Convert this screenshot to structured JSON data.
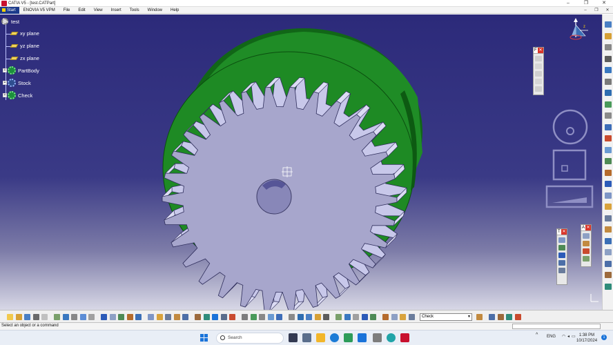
{
  "window": {
    "title": "CATIA V5 - [test.CATPart]",
    "controls": [
      "–",
      "❐",
      "✕"
    ]
  },
  "menu": {
    "start": "Start",
    "items": [
      "ENOVIA V5 VPM",
      "File",
      "Edit",
      "View",
      "Insert",
      "Tools",
      "Window",
      "Help"
    ],
    "doc_controls": [
      "–",
      "❐",
      "✕"
    ]
  },
  "tree": {
    "root": "test",
    "items": [
      "xy plane",
      "yz plane",
      "zx plane",
      "PartBody",
      "Stock",
      "Check"
    ]
  },
  "floating_toolbars": {
    "t1_title": "F",
    "t2_title": "T",
    "t3_title": "A"
  },
  "bottom_toolbar": {
    "select_value": "Check"
  },
  "status": {
    "message": "Select an object or a command"
  },
  "taskbar": {
    "search_placeholder": "Search",
    "lang": "ENG",
    "time": "1:38 PM",
    "date": "10/17/2024",
    "notif": "1"
  },
  "colors": {
    "bg_top": "#2c2a7a",
    "bg_bottom": "#d8d8e6",
    "gear_face": "#a7a6cc",
    "gear_edge": "#c8c8ea",
    "stock_green": "#1e8a24",
    "stock_dark": "#116617",
    "catia_red": "#c8102e"
  },
  "icons": [
    "compass-icon",
    "gear-icon",
    "plane-icon",
    "close-icon",
    "search-icon",
    "windows-icon",
    "wifi-icon",
    "speaker-icon",
    "battery-icon"
  ]
}
